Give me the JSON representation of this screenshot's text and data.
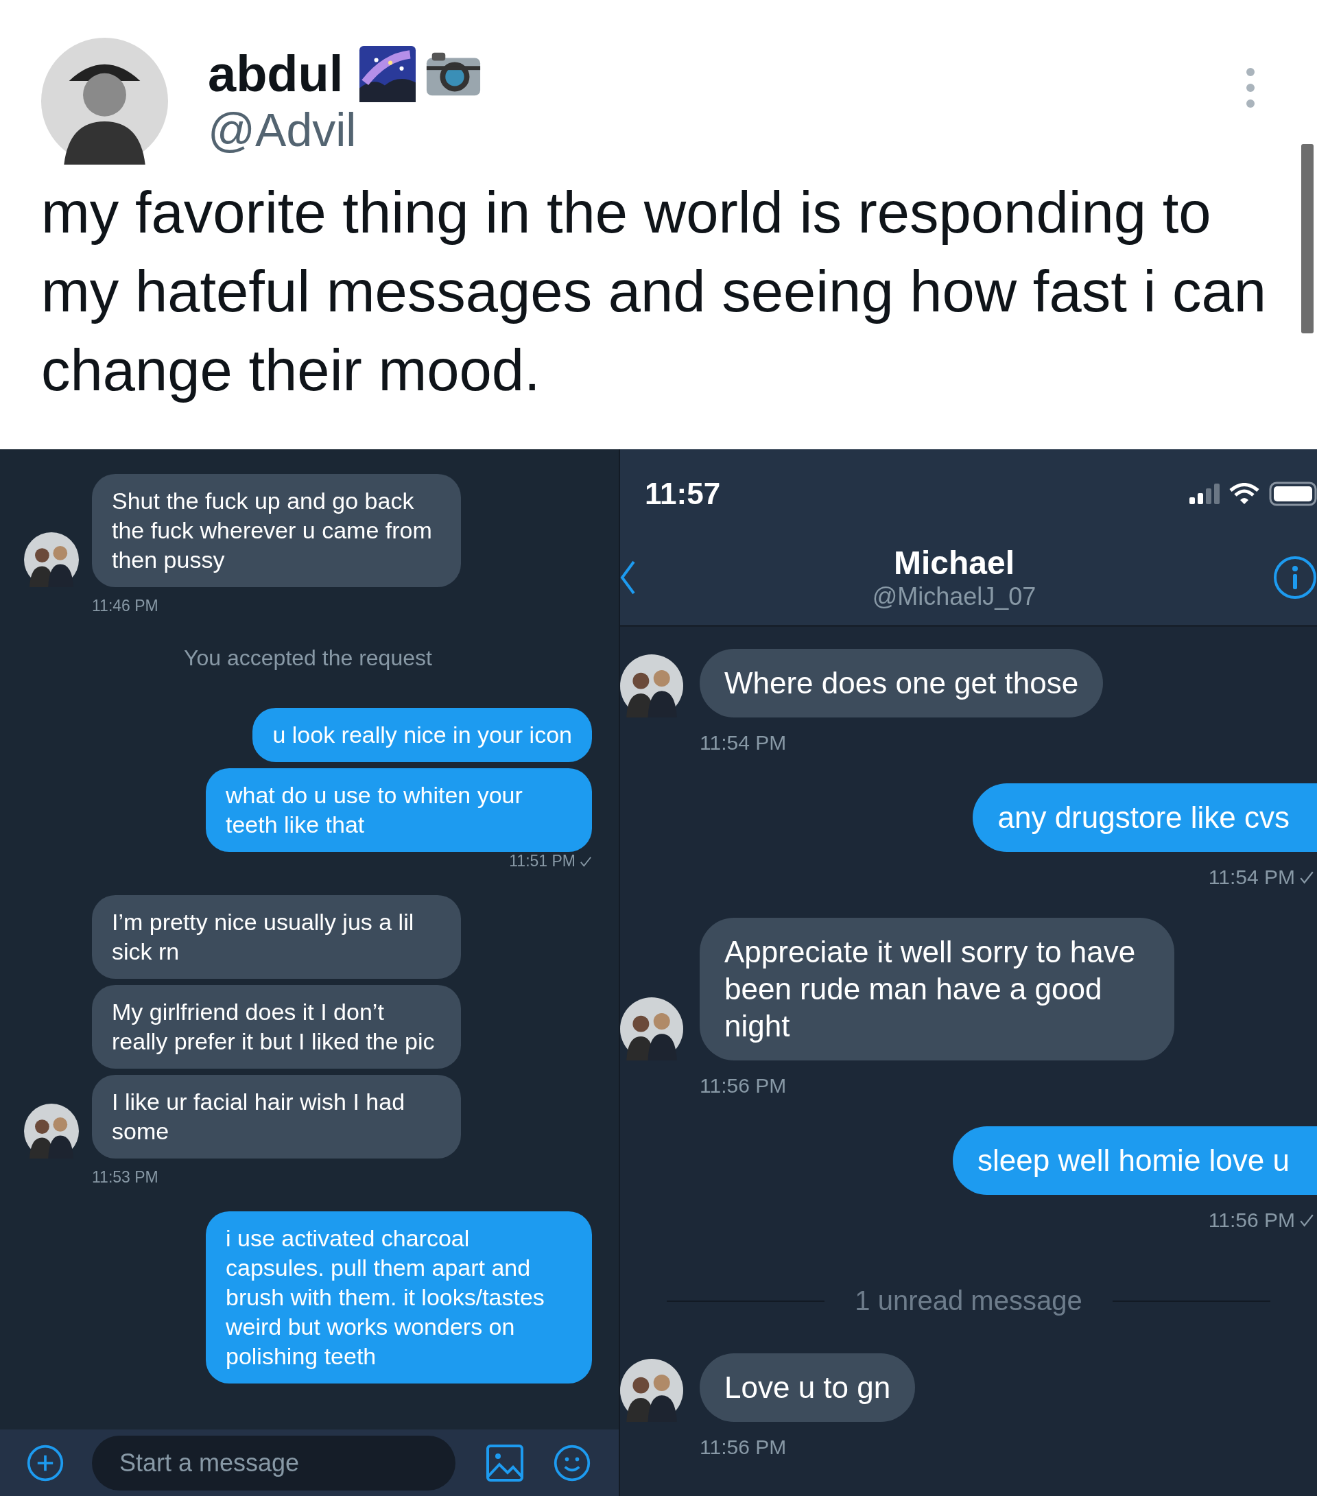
{
  "tweet": {
    "name": "abdul",
    "handle": "@Advil",
    "text": "my favorite thing in the world is responding to my hateful messages and seeing how fast i can change their mood."
  },
  "left_chat": {
    "items": [
      {
        "kind": "received",
        "messages": [
          "Shut the fuck up and go back the fuck wherever u came from then pussy"
        ],
        "time": "11:46 PM"
      },
      {
        "kind": "notice",
        "text": "You accepted the request"
      },
      {
        "kind": "sent",
        "messages": [
          "u look really nice in your icon",
          "what do u use to whiten your teeth like that"
        ],
        "time": "11:51 PM",
        "check": true
      },
      {
        "kind": "received",
        "messages": [
          "I’m pretty nice usually jus a lil sick rn",
          "My girlfriend does it I don’t really prefer it but I liked the pic",
          "I like ur facial hair wish I had some"
        ],
        "time": "11:53 PM"
      },
      {
        "kind": "sent",
        "messages": [
          "i use activated charcoal capsules. pull them apart and brush with them. it looks/tastes weird but works wonders on polishing teeth"
        ]
      }
    ],
    "composer": {
      "placeholder": "Start a message"
    }
  },
  "right_chat": {
    "status_bar": {
      "time": "11:57"
    },
    "header": {
      "name": "Michael",
      "handle": "@MichaelJ_07"
    },
    "items": [
      {
        "kind": "received",
        "messages": [
          "Where does one get those"
        ],
        "time": "11:54 PM"
      },
      {
        "kind": "sent",
        "messages": [
          "any drugstore like cvs"
        ],
        "time": "11:54 PM",
        "check": true
      },
      {
        "kind": "received",
        "messages": [
          "Appreciate it well sorry to have been rude man have a good night"
        ],
        "time": "11:56 PM"
      },
      {
        "kind": "sent",
        "messages": [
          "sleep well homie love u"
        ],
        "time": "11:56 PM",
        "check": true
      },
      {
        "kind": "divider",
        "text": "1 unread message"
      },
      {
        "kind": "received",
        "messages": [
          "Love u to gn"
        ],
        "time": "11:56 PM"
      }
    ]
  }
}
